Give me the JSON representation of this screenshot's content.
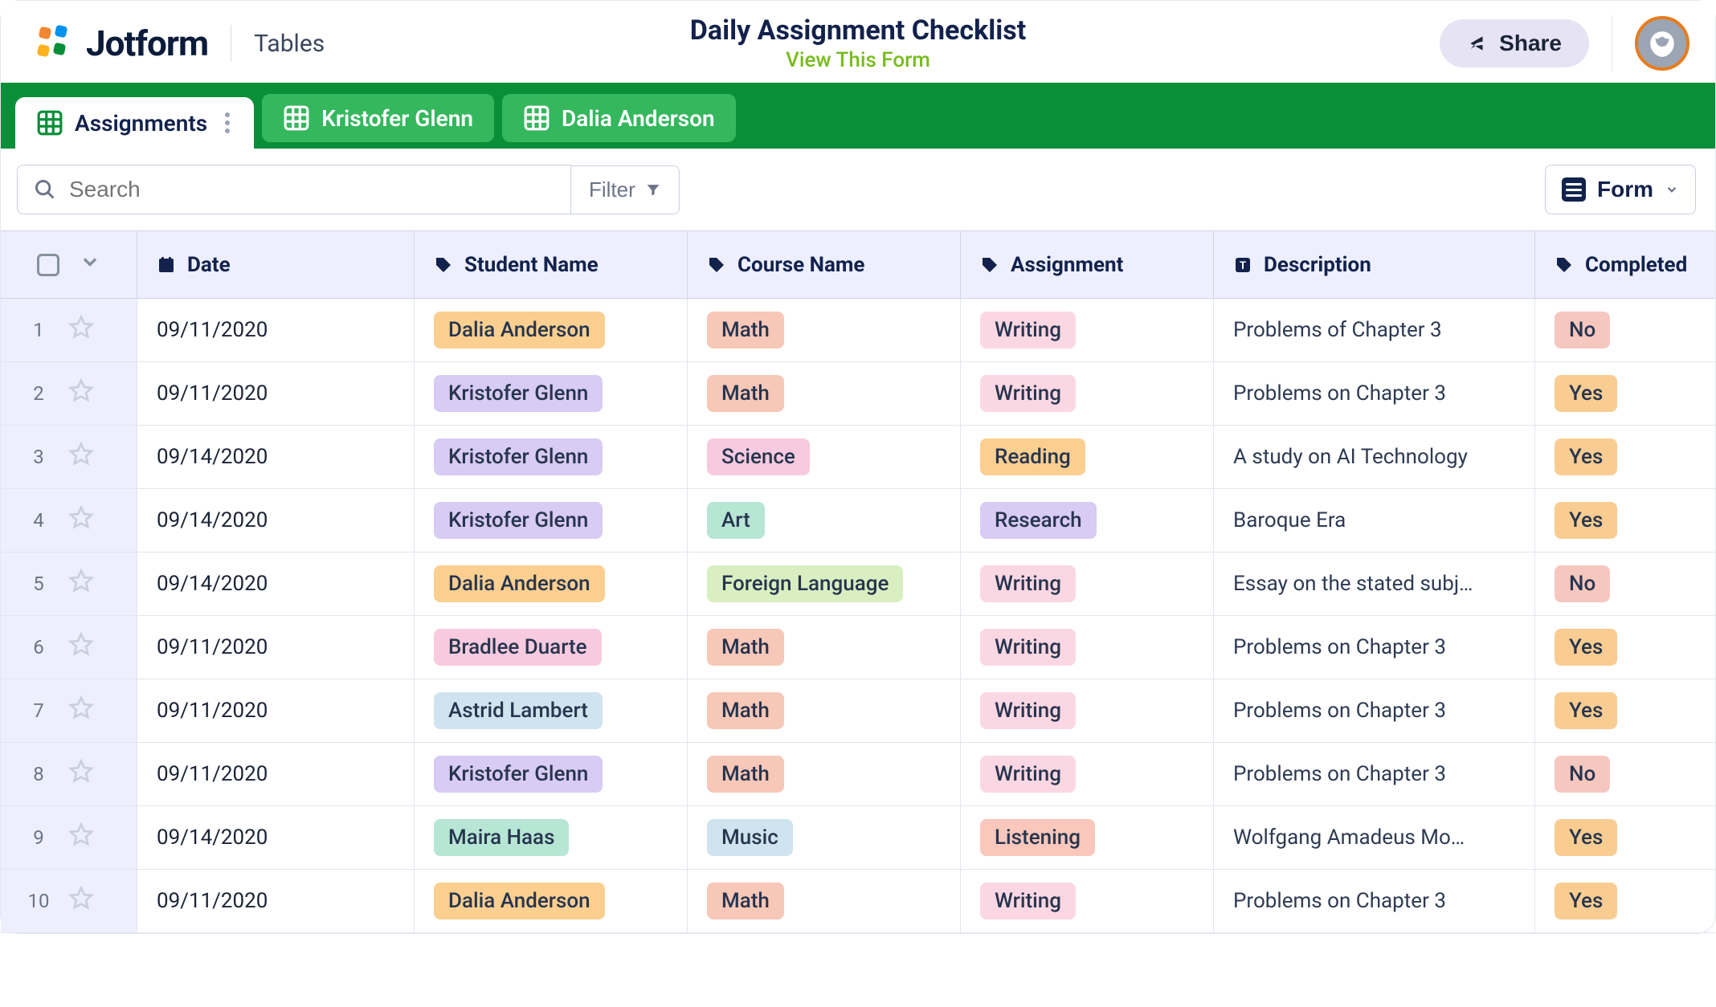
{
  "header": {
    "brand": "Jotform",
    "section": "Tables",
    "title": "Daily Assignment Checklist",
    "view_link": "View This Form",
    "share": "Share"
  },
  "tabs": [
    {
      "label": "Assignments",
      "active": true
    },
    {
      "label": "Kristofer Glenn",
      "active": false
    },
    {
      "label": "Dalia Anderson",
      "active": false
    }
  ],
  "toolbar": {
    "search_placeholder": "Search",
    "filter": "Filter",
    "form": "Form"
  },
  "columns": {
    "date": "Date",
    "student": "Student Name",
    "course": "Course Name",
    "assignment": "Assignment",
    "description": "Description",
    "completed": "Completed"
  },
  "rows": [
    {
      "n": "1",
      "date": "09/11/2020",
      "student": {
        "text": "Dalia Anderson",
        "c": "orange"
      },
      "course": {
        "text": "Math",
        "c": "peach"
      },
      "assignment": {
        "text": "Writing",
        "c": "lpink"
      },
      "description": "Problems of Chapter 3",
      "completed": {
        "text": "No",
        "c": "no"
      }
    },
    {
      "n": "2",
      "date": "09/11/2020",
      "student": {
        "text": "Kristofer Glenn",
        "c": "purple"
      },
      "course": {
        "text": "Math",
        "c": "peach"
      },
      "assignment": {
        "text": "Writing",
        "c": "lpink"
      },
      "description": "Problems on Chapter 3",
      "completed": {
        "text": "Yes",
        "c": "yes"
      }
    },
    {
      "n": "3",
      "date": "09/14/2020",
      "student": {
        "text": "Kristofer Glenn",
        "c": "purple"
      },
      "course": {
        "text": "Science",
        "c": "pink"
      },
      "assignment": {
        "text": "Reading",
        "c": "orange"
      },
      "description": "A study on AI Technology",
      "completed": {
        "text": "Yes",
        "c": "yes"
      }
    },
    {
      "n": "4",
      "date": "09/14/2020",
      "student": {
        "text": "Kristofer Glenn",
        "c": "purple"
      },
      "course": {
        "text": "Art",
        "c": "teal"
      },
      "assignment": {
        "text": "Research",
        "c": "violet"
      },
      "description": "Baroque Era",
      "completed": {
        "text": "Yes",
        "c": "yes"
      }
    },
    {
      "n": "5",
      "date": "09/14/2020",
      "student": {
        "text": "Dalia Anderson",
        "c": "orange"
      },
      "course": {
        "text": "Foreign Language",
        "c": "green"
      },
      "assignment": {
        "text": "Writing",
        "c": "lpink"
      },
      "description": "Essay on the stated subj…",
      "completed": {
        "text": "No",
        "c": "no"
      }
    },
    {
      "n": "6",
      "date": "09/11/2020",
      "student": {
        "text": "Bradlee Duarte",
        "c": "pink"
      },
      "course": {
        "text": "Math",
        "c": "peach"
      },
      "assignment": {
        "text": "Writing",
        "c": "lpink"
      },
      "description": "Problems on Chapter 3",
      "completed": {
        "text": "Yes",
        "c": "yes"
      }
    },
    {
      "n": "7",
      "date": "09/11/2020",
      "student": {
        "text": "Astrid Lambert",
        "c": "lightblue"
      },
      "course": {
        "text": "Math",
        "c": "peach"
      },
      "assignment": {
        "text": "Writing",
        "c": "lpink"
      },
      "description": "Problems on Chapter 3",
      "completed": {
        "text": "Yes",
        "c": "yes"
      }
    },
    {
      "n": "8",
      "date": "09/11/2020",
      "student": {
        "text": "Kristofer Glenn",
        "c": "purple"
      },
      "course": {
        "text": "Math",
        "c": "peach"
      },
      "assignment": {
        "text": "Writing",
        "c": "lpink"
      },
      "description": "Problems on Chapter 3",
      "completed": {
        "text": "No",
        "c": "no"
      }
    },
    {
      "n": "9",
      "date": "09/14/2020",
      "student": {
        "text": "Maira Haas",
        "c": "mint"
      },
      "course": {
        "text": "Music",
        "c": "bluegrey"
      },
      "assignment": {
        "text": "Listening",
        "c": "salmon"
      },
      "description": "Wolfgang Amadeus Mo…",
      "completed": {
        "text": "Yes",
        "c": "yes"
      }
    },
    {
      "n": "10",
      "date": "09/11/2020",
      "student": {
        "text": "Dalia Anderson",
        "c": "orange"
      },
      "course": {
        "text": "Math",
        "c": "peach"
      },
      "assignment": {
        "text": "Writing",
        "c": "lpink"
      },
      "description": "Problems on Chapter 3",
      "completed": {
        "text": "Yes",
        "c": "yes"
      }
    }
  ]
}
